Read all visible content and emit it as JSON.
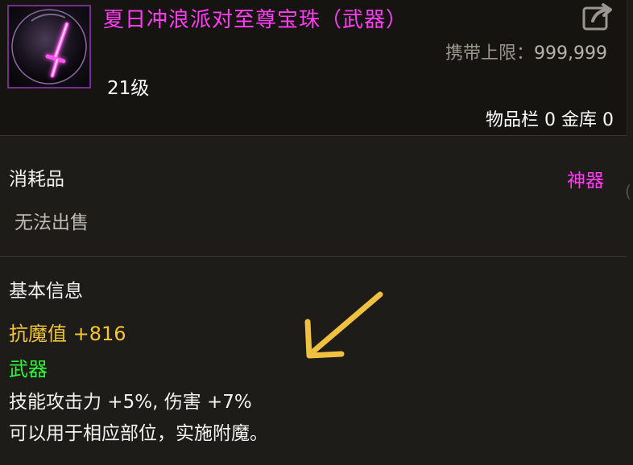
{
  "item": {
    "name": "夏日冲浪派对至尊宝珠（武器）",
    "level": "21级",
    "carry_limit_label": "携带上限：",
    "carry_limit_value": "999,999",
    "inventory_text": "物品栏 0 金库 0",
    "category": "消耗品",
    "rarity": "神器",
    "sell_status": "无法出售"
  },
  "info": {
    "section_title": "基本信息",
    "magic_resist": "抗魔值 +816",
    "slot": "武器",
    "effect_line1": "技能攻击力 +5%, 伤害 +7%",
    "effect_line2": "可以用于相应部位，实施附魔。"
  },
  "background": {
    "partial_glyph": "("
  },
  "colors": {
    "item_name": "#ff3df2",
    "rarity": "#ff3df2",
    "stat_magic": "#f4c536",
    "slot": "#2ff53a",
    "annotation_arrow": "#f0c040",
    "icon_border": "#7a2c8e"
  },
  "icons": {
    "item_icon": "glowing-sword-orb-icon",
    "share": "share-export-icon",
    "annotation": "arrow-annotation-icon"
  }
}
